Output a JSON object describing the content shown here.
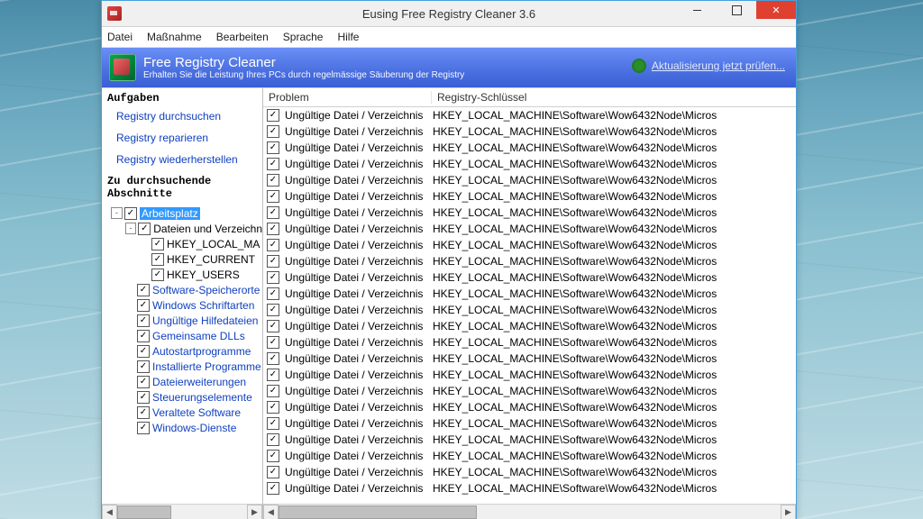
{
  "window": {
    "title": "Eusing Free Registry Cleaner 3.6"
  },
  "menu": [
    "Datei",
    "Maßnahme",
    "Bearbeiten",
    "Sprache",
    "Hilfe"
  ],
  "banner": {
    "title": "Free Registry Cleaner",
    "subtitle": "Erhalten Sie die Leistung Ihres PCs durch regelmässige Säuberung der Registry",
    "update": "Aktualisierung jetzt prüfen..."
  },
  "left": {
    "tasks_header": "Aufgaben",
    "tasks": [
      "Registry durchsuchen",
      "Registry reparieren",
      "Registry wiederherstellen"
    ],
    "sections_header": "Zu durchsuchende Abschnitte",
    "tree": [
      {
        "depth": 0,
        "tw": "-",
        "checked": true,
        "label": "Arbeitsplatz",
        "selected": true
      },
      {
        "depth": 1,
        "tw": "-",
        "checked": true,
        "label": "Dateien und Verzeichn"
      },
      {
        "depth": 2,
        "tw": "",
        "checked": true,
        "label": "HKEY_LOCAL_MA"
      },
      {
        "depth": 2,
        "tw": "",
        "checked": true,
        "label": "HKEY_CURRENT"
      },
      {
        "depth": 2,
        "tw": "",
        "checked": true,
        "label": "HKEY_USERS"
      },
      {
        "depth": 1,
        "tw": "",
        "checked": true,
        "label": "Software-Speicherorte",
        "blue": true
      },
      {
        "depth": 1,
        "tw": "",
        "checked": true,
        "label": "Windows Schriftarten",
        "blue": true
      },
      {
        "depth": 1,
        "tw": "",
        "checked": true,
        "label": "Ungültige Hilfedateien",
        "blue": true
      },
      {
        "depth": 1,
        "tw": "",
        "checked": true,
        "label": "Gemeinsame DLLs",
        "blue": true
      },
      {
        "depth": 1,
        "tw": "",
        "checked": true,
        "label": "Autostartprogramme",
        "blue": true
      },
      {
        "depth": 1,
        "tw": "",
        "checked": true,
        "label": "Installierte Programme",
        "blue": true
      },
      {
        "depth": 1,
        "tw": "",
        "checked": true,
        "label": "Dateierweiterungen",
        "blue": true
      },
      {
        "depth": 1,
        "tw": "",
        "checked": true,
        "label": "Steuerungselemente",
        "blue": true
      },
      {
        "depth": 1,
        "tw": "",
        "checked": true,
        "label": "Veraltete Software",
        "blue": true
      },
      {
        "depth": 1,
        "tw": "",
        "checked": true,
        "label": "Windows-Dienste",
        "blue": true
      }
    ]
  },
  "right": {
    "col1": "Problem",
    "col2": "Registry-Schlüssel",
    "row_problem": "Ungültige Datei / Verzeichnis",
    "row_key": "HKEY_LOCAL_MACHINE\\Software\\Wow6432Node\\Micros",
    "row_count": 24
  }
}
